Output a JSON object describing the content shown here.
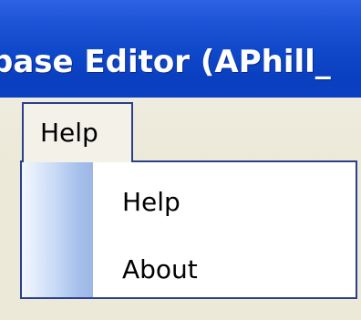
{
  "window": {
    "title": "base Editor (APhill_"
  },
  "menubar": {
    "items": [
      {
        "label": "Help"
      }
    ]
  },
  "help_menu": {
    "items": [
      {
        "label": "Help"
      },
      {
        "label": "About"
      }
    ]
  },
  "colors": {
    "titlebar": "#0e47c9",
    "menu_border": "#2b3f8c",
    "menubar_bg": "#ece9d8"
  }
}
